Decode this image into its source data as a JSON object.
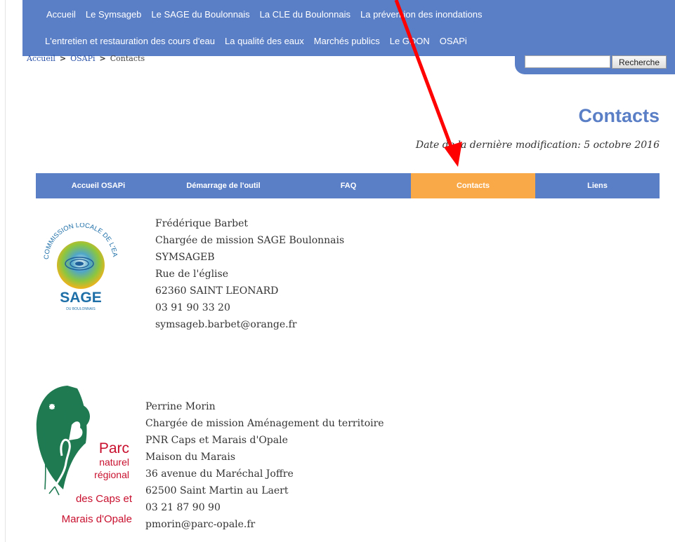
{
  "nav": {
    "row1": [
      "Accueil",
      "Le Symsageb",
      "Le SAGE du Boulonnais",
      "La CLE du Boulonnais",
      "La prévention des inondations"
    ],
    "row2": [
      "L'entretien et restauration des cours d'eau",
      "La qualité des eaux",
      "Marchés publics",
      "Le GDON",
      "OSAPi"
    ]
  },
  "search": {
    "placeholder": "",
    "button": "Recherche"
  },
  "breadcrumb": {
    "home": "Accueil",
    "section": "OSAPi",
    "current": "Contacts",
    "sep": ">"
  },
  "page": {
    "title": "Contacts",
    "modified": "Date de la dernière modification: 5 octobre 2016"
  },
  "tabs": [
    "Accueil OSAPi",
    "Démarrage de l'outil",
    "FAQ",
    "Contacts",
    "Liens"
  ],
  "contacts": [
    {
      "lines": [
        "Frédérique Barbet",
        "Chargée de mission SAGE Boulonnais",
        "SYMSAGEB",
        "Rue de l'église",
        "62360 SAINT LEONARD",
        "03 91 90 33 20",
        "symsageb.barbet@orange.fr"
      ],
      "logo_text": {
        "arc": "COMMISSION LOCALE DE L'EAU",
        "main": "SAGE",
        "sub": "DU BOULONNAIS"
      }
    },
    {
      "lines": [
        "Perrine Morin",
        "Chargée de mission Aménagement du territoire",
        "PNR Caps et Marais d'Opale",
        "Maison du Marais",
        "36 avenue du Maréchal Joffre",
        "62500 Saint Martin au Laert",
        "03 21 87 90 90",
        "pmorin@parc-opale.fr"
      ],
      "logo_text": {
        "l1": "Parc",
        "l2": "naturel",
        "l3": "régional",
        "l4": "des Caps et",
        "l5": "Marais d'Opale"
      }
    }
  ],
  "colors": {
    "nav": "#5b7fc6",
    "active_tab": "#f9a948",
    "title": "#5b7fc6",
    "arrow": "#ff0000"
  }
}
